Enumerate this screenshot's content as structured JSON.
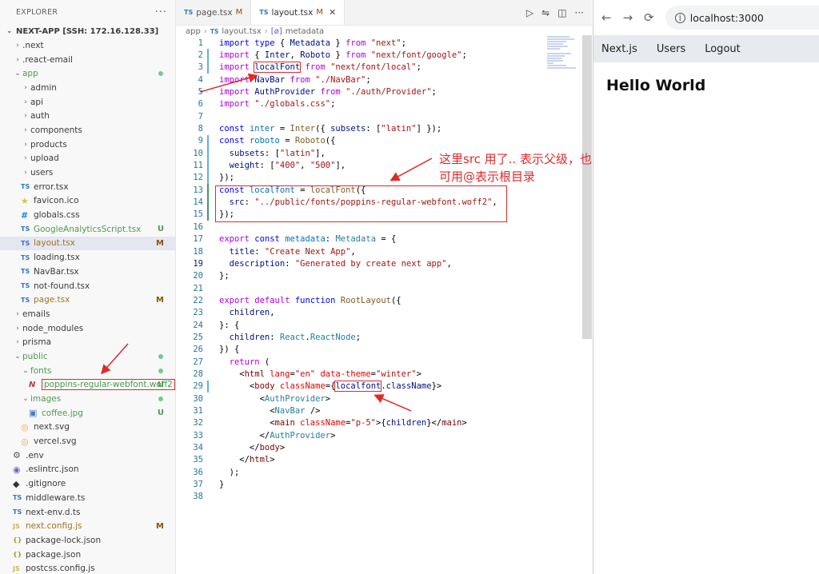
{
  "explorer": {
    "title": "EXPLORER",
    "more": "···",
    "root": "NEXT-APP [SSH: 172.16.128.33]",
    "items": [
      {
        "label": ".next",
        "depth": 1,
        "kind": "folder",
        "open": false
      },
      {
        "label": ".react-email",
        "depth": 1,
        "kind": "folder",
        "open": false
      },
      {
        "label": "app",
        "depth": 1,
        "kind": "folder",
        "open": true,
        "dot": true,
        "color": "green"
      },
      {
        "label": "admin",
        "depth": 2,
        "kind": "folder",
        "open": false
      },
      {
        "label": "api",
        "depth": 2,
        "kind": "folder",
        "open": false
      },
      {
        "label": "auth",
        "depth": 2,
        "kind": "folder",
        "open": false
      },
      {
        "label": "components",
        "depth": 2,
        "kind": "folder",
        "open": false
      },
      {
        "label": "products",
        "depth": 2,
        "kind": "folder",
        "open": false
      },
      {
        "label": "upload",
        "depth": 2,
        "kind": "folder",
        "open": false
      },
      {
        "label": "users",
        "depth": 2,
        "kind": "folder",
        "open": false
      },
      {
        "label": "error.tsx",
        "depth": 2,
        "kind": "ts"
      },
      {
        "label": "favicon.ico",
        "depth": 2,
        "kind": "star"
      },
      {
        "label": "globals.css",
        "depth": 2,
        "kind": "css"
      },
      {
        "label": "GoogleAnalyticsScript.tsx",
        "depth": 2,
        "kind": "ts",
        "badge": "U",
        "color": "green"
      },
      {
        "label": "layout.tsx",
        "depth": 2,
        "kind": "ts",
        "badge": "M",
        "color": "brown",
        "selected": true
      },
      {
        "label": "loading.tsx",
        "depth": 2,
        "kind": "ts"
      },
      {
        "label": "NavBar.tsx",
        "depth": 2,
        "kind": "ts"
      },
      {
        "label": "not-found.tsx",
        "depth": 2,
        "kind": "ts"
      },
      {
        "label": "page.tsx",
        "depth": 2,
        "kind": "ts",
        "badge": "M",
        "color": "brown"
      },
      {
        "label": "emails",
        "depth": 1,
        "kind": "folder",
        "open": false
      },
      {
        "label": "node_modules",
        "depth": 1,
        "kind": "folder",
        "open": false
      },
      {
        "label": "prisma",
        "depth": 1,
        "kind": "folder",
        "open": false
      },
      {
        "label": "public",
        "depth": 1,
        "kind": "folder",
        "open": true,
        "dot": true,
        "color": "green"
      },
      {
        "label": "fonts",
        "depth": 2,
        "kind": "folder",
        "open": true,
        "dot": true,
        "color": "green"
      },
      {
        "label": "poppins-regular-webfont.woff2",
        "depth": 3,
        "kind": "font",
        "badge": "U",
        "color": "green",
        "boxed": true
      },
      {
        "label": "images",
        "depth": 2,
        "kind": "folder",
        "open": true,
        "dot": true,
        "color": "green"
      },
      {
        "label": "coffee.jpg",
        "depth": 3,
        "kind": "img",
        "badge": "U",
        "color": "green"
      },
      {
        "label": "next.svg",
        "depth": 2,
        "kind": "svg"
      },
      {
        "label": "vercel.svg",
        "depth": 2,
        "kind": "svg"
      },
      {
        "label": ".env",
        "depth": 1,
        "kind": "gear"
      },
      {
        "label": ".eslintrc.json",
        "depth": 1,
        "kind": "lint"
      },
      {
        "label": ".gitignore",
        "depth": 1,
        "kind": "git"
      },
      {
        "label": "middleware.ts",
        "depth": 1,
        "kind": "ts"
      },
      {
        "label": "next-env.d.ts",
        "depth": 1,
        "kind": "ts"
      },
      {
        "label": "next.config.js",
        "depth": 1,
        "kind": "js",
        "badge": "M",
        "color": "brown"
      },
      {
        "label": "package-lock.json",
        "depth": 1,
        "kind": "json"
      },
      {
        "label": "package.json",
        "depth": 1,
        "kind": "json"
      },
      {
        "label": "postcss.config.js",
        "depth": 1,
        "kind": "js"
      }
    ]
  },
  "editor": {
    "tabs": [
      {
        "icon": "TS",
        "label": "page.tsx",
        "status": "M",
        "active": false
      },
      {
        "icon": "TS",
        "label": "layout.tsx",
        "status": "M",
        "active": true,
        "close": "✕"
      }
    ],
    "breadcrumb": {
      "folder": "app",
      "icon": "TS",
      "file": "layout.tsx",
      "symbol": "metadata",
      "symbol_icon": "[ø]"
    },
    "lines": [
      {
        "n": "1",
        "g": "",
        "t": [
          [
            "kw",
            "import "
          ],
          [
            "kw",
            "type "
          ],
          [
            "txt",
            "{ "
          ],
          [
            "vr",
            "Metadata"
          ],
          [
            "txt",
            " } "
          ],
          [
            "kw2",
            "from "
          ],
          [
            "str",
            "\"next\""
          ],
          [
            "txt",
            ";"
          ]
        ]
      },
      {
        "n": "2",
        "g": "mod",
        "t": [
          [
            "kw2",
            "import "
          ],
          [
            "txt",
            "{ "
          ],
          [
            "vr",
            "Inter"
          ],
          [
            "txt",
            ", "
          ],
          [
            "vr",
            "Roboto"
          ],
          [
            "txt",
            " } "
          ],
          [
            "kw2",
            "from "
          ],
          [
            "str",
            "\"next/font/google\""
          ],
          [
            "txt",
            ";"
          ]
        ]
      },
      {
        "n": "3",
        "g": "mod",
        "t": [
          [
            "kw2",
            "import "
          ],
          [
            "vrbox",
            "localFont"
          ],
          [
            "txt",
            " "
          ],
          [
            "kw2",
            "from "
          ],
          [
            "str",
            "\"next/font/local\""
          ],
          [
            "txt",
            ";"
          ]
        ]
      },
      {
        "n": "4",
        "g": "",
        "t": [
          [
            "kw2",
            "import "
          ],
          [
            "vr",
            "NavBar "
          ],
          [
            "kw2",
            "from "
          ],
          [
            "str",
            "\"./NavBar\""
          ],
          [
            "txt",
            ";"
          ]
        ]
      },
      {
        "n": "5",
        "g": "",
        "t": [
          [
            "kw2",
            "import "
          ],
          [
            "vr",
            "AuthProvider "
          ],
          [
            "kw2",
            "from "
          ],
          [
            "str",
            "\"./auth/Provider\""
          ],
          [
            "txt",
            ";"
          ]
        ]
      },
      {
        "n": "6",
        "g": "",
        "t": [
          [
            "kw2",
            "import "
          ],
          [
            "str",
            "\"./globals.css\""
          ],
          [
            "txt",
            ";"
          ]
        ]
      },
      {
        "n": "7",
        "g": "",
        "t": []
      },
      {
        "n": "8",
        "g": "",
        "t": [
          [
            "kw",
            "const "
          ],
          [
            "cn",
            "inter"
          ],
          [
            "txt",
            " = "
          ],
          [
            "fn",
            "Inter"
          ],
          [
            "txt",
            "({ "
          ],
          [
            "vr",
            "subsets"
          ],
          [
            "txt",
            ": ["
          ],
          [
            "str",
            "\"latin\""
          ],
          [
            "txt",
            "] });"
          ]
        ]
      },
      {
        "n": "9",
        "g": "mod",
        "t": [
          [
            "kw",
            "const "
          ],
          [
            "cn",
            "roboto"
          ],
          [
            "txt",
            " = "
          ],
          [
            "fn",
            "Roboto"
          ],
          [
            "txt",
            "({"
          ]
        ]
      },
      {
        "n": "10",
        "g": "mod",
        "t": [
          [
            "txt",
            "  "
          ],
          [
            "vr",
            "subsets"
          ],
          [
            "txt",
            ": ["
          ],
          [
            "str",
            "\"latin\""
          ],
          [
            "txt",
            "],"
          ]
        ]
      },
      {
        "n": "11",
        "g": "mod",
        "t": [
          [
            "txt",
            "  "
          ],
          [
            "vr",
            "weight"
          ],
          [
            "txt",
            ": ["
          ],
          [
            "str",
            "\"400\""
          ],
          [
            "txt",
            ", "
          ],
          [
            "str",
            "\"500\""
          ],
          [
            "txt",
            "],"
          ]
        ]
      },
      {
        "n": "12",
        "g": "mod",
        "t": [
          [
            "txt",
            "});"
          ]
        ]
      },
      {
        "n": "13",
        "g": "add",
        "t": [
          [
            "kw",
            "const "
          ],
          [
            "cn",
            "localfont"
          ],
          [
            "txt",
            " = "
          ],
          [
            "fn",
            "localFont"
          ],
          [
            "txt",
            "({"
          ]
        ]
      },
      {
        "n": "14",
        "g": "add",
        "t": [
          [
            "txt",
            "  "
          ],
          [
            "vr",
            "src"
          ],
          [
            "txt",
            ": "
          ],
          [
            "str",
            "\"../public/fonts/poppins-regular-webfont.woff2\""
          ],
          [
            "txt",
            ","
          ]
        ]
      },
      {
        "n": "15",
        "g": "add",
        "t": [
          [
            "txt",
            "});"
          ]
        ]
      },
      {
        "n": "16",
        "g": "",
        "t": []
      },
      {
        "n": "17",
        "g": "",
        "t": [
          [
            "kw2",
            "export "
          ],
          [
            "kw",
            "const "
          ],
          [
            "cn",
            "metadata"
          ],
          [
            "txt",
            ": "
          ],
          [
            "ty",
            "Metadata"
          ],
          [
            "txt",
            " = {"
          ]
        ]
      },
      {
        "n": "18",
        "g": "",
        "t": [
          [
            "txt",
            "  "
          ],
          [
            "vr",
            "title"
          ],
          [
            "txt",
            ": "
          ],
          [
            "str",
            "\"Create Next App\""
          ],
          [
            "txt",
            ","
          ]
        ]
      },
      {
        "n": "19",
        "g": "",
        "t": [
          [
            "txt",
            "  "
          ],
          [
            "vr",
            "description"
          ],
          [
            "txt",
            ": "
          ],
          [
            "str",
            "\"Generated by create next app\""
          ],
          [
            "txt",
            ","
          ]
        ],
        "cur": true
      },
      {
        "n": "20",
        "g": "",
        "t": [
          [
            "txt",
            "};"
          ]
        ]
      },
      {
        "n": "21",
        "g": "",
        "t": []
      },
      {
        "n": "22",
        "g": "",
        "t": [
          [
            "kw2",
            "export "
          ],
          [
            "kw2",
            "default "
          ],
          [
            "kw",
            "function "
          ],
          [
            "fn",
            "RootLayout"
          ],
          [
            "txt",
            "({"
          ]
        ]
      },
      {
        "n": "23",
        "g": "",
        "t": [
          [
            "txt",
            "  "
          ],
          [
            "vr",
            "children"
          ],
          [
            "txt",
            ","
          ]
        ]
      },
      {
        "n": "24",
        "g": "",
        "t": [
          [
            "txt",
            "}: {"
          ]
        ]
      },
      {
        "n": "25",
        "g": "",
        "t": [
          [
            "txt",
            "  "
          ],
          [
            "vr",
            "children"
          ],
          [
            "txt",
            ": "
          ],
          [
            "ty",
            "React"
          ],
          [
            "txt",
            "."
          ],
          [
            "ty",
            "ReactNode"
          ],
          [
            "txt",
            ";"
          ]
        ]
      },
      {
        "n": "26",
        "g": "",
        "t": [
          [
            "txt",
            "}) {"
          ]
        ]
      },
      {
        "n": "27",
        "g": "",
        "t": [
          [
            "txt",
            "  "
          ],
          [
            "kw2",
            "return "
          ],
          [
            "txt",
            "("
          ]
        ]
      },
      {
        "n": "28",
        "g": "",
        "t": [
          [
            "txt",
            "    <"
          ],
          [
            "tag",
            "html "
          ],
          [
            "attr",
            "lang"
          ],
          [
            "txt",
            "="
          ],
          [
            "str",
            "\"en\" "
          ],
          [
            "attr",
            "data-theme"
          ],
          [
            "txt",
            "="
          ],
          [
            "str",
            "\"winter\""
          ],
          [
            "txt",
            ">"
          ]
        ]
      },
      {
        "n": "29",
        "g": "mod",
        "t": [
          [
            "txt",
            "      <"
          ],
          [
            "tag",
            "body "
          ],
          [
            "attr",
            "className"
          ],
          [
            "txt",
            "={"
          ],
          [
            "vrbox",
            "localfont"
          ],
          [
            "txt",
            "."
          ],
          [
            "vr",
            "className"
          ],
          [
            "txt",
            "}>"
          ]
        ]
      },
      {
        "n": "30",
        "g": "",
        "t": [
          [
            "txt",
            "        <"
          ],
          [
            "ty",
            "AuthProvider"
          ],
          [
            "txt",
            ">"
          ]
        ]
      },
      {
        "n": "31",
        "g": "",
        "t": [
          [
            "txt",
            "          <"
          ],
          [
            "ty",
            "NavBar "
          ],
          [
            "txt",
            "/>"
          ]
        ]
      },
      {
        "n": "32",
        "g": "",
        "t": [
          [
            "txt",
            "          <"
          ],
          [
            "tag",
            "main "
          ],
          [
            "attr",
            "className"
          ],
          [
            "txt",
            "="
          ],
          [
            "str",
            "\"p-5\""
          ],
          [
            "txt",
            ">{"
          ],
          [
            "vr",
            "children"
          ],
          [
            "txt",
            "}</"
          ],
          [
            "tag",
            "main"
          ],
          [
            "txt",
            ">"
          ]
        ]
      },
      {
        "n": "33",
        "g": "",
        "t": [
          [
            "txt",
            "        </"
          ],
          [
            "ty",
            "AuthProvider"
          ],
          [
            "txt",
            ">"
          ]
        ]
      },
      {
        "n": "34",
        "g": "",
        "t": [
          [
            "txt",
            "      </"
          ],
          [
            "tag",
            "body"
          ],
          [
            "txt",
            ">"
          ]
        ]
      },
      {
        "n": "35",
        "g": "",
        "t": [
          [
            "txt",
            "    </"
          ],
          [
            "tag",
            "html"
          ],
          [
            "txt",
            ">"
          ]
        ]
      },
      {
        "n": "36",
        "g": "",
        "t": [
          [
            "txt",
            "  );"
          ]
        ]
      },
      {
        "n": "37",
        "g": "",
        "t": [
          [
            "txt",
            "}"
          ]
        ]
      },
      {
        "n": "38",
        "g": "",
        "t": []
      }
    ],
    "annotation": "这里src 用了.. 表示父级，也可用@表示根目录"
  },
  "browser": {
    "url": "localhost:3000",
    "nav": [
      "Next.js",
      "Users",
      "Logout"
    ],
    "heading": "Hello World"
  },
  "colors": {
    "annotation_red": "#e02a2a",
    "git_untracked": "#4e9a4e",
    "git_modified": "#895503"
  }
}
